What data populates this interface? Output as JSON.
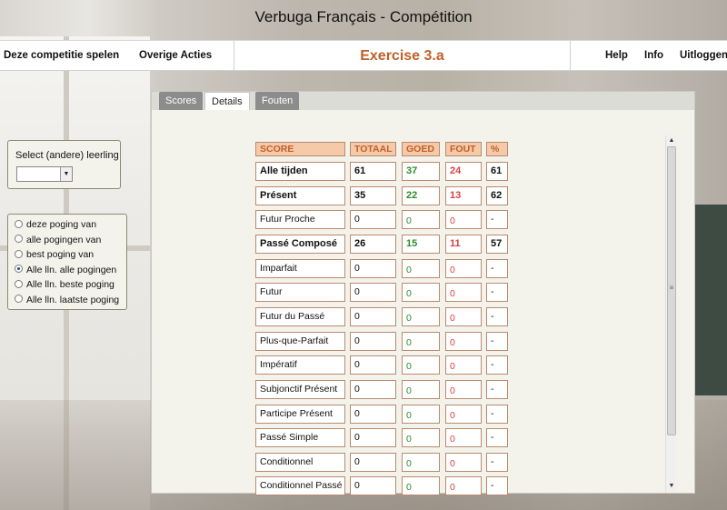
{
  "app": {
    "title": "Verbuga Français - Compétition"
  },
  "menu": {
    "left": [
      "Deze competitie spelen",
      "Overige Acties"
    ],
    "center": "Exercise 3.a",
    "right": [
      "Help",
      "Info",
      "Uitloggen"
    ]
  },
  "tabs": [
    {
      "label": "Scores",
      "active": false
    },
    {
      "label": "Details",
      "active": true
    },
    {
      "label": "Fouten",
      "active": false
    }
  ],
  "table": {
    "headers": [
      "SCORE",
      "TOTAAL",
      "GOED",
      "FOUT",
      "%"
    ],
    "rows": [
      {
        "name": "Alle tijden",
        "totaal": "61",
        "goed": "37",
        "fout": "24",
        "pct": "61",
        "bold": true
      },
      {
        "name": "Présent",
        "totaal": "35",
        "goed": "22",
        "fout": "13",
        "pct": "62",
        "bold": true
      },
      {
        "name": "Futur Proche",
        "totaal": "0",
        "goed": "0",
        "fout": "0",
        "pct": "-",
        "bold": false
      },
      {
        "name": "Passé Composé",
        "totaal": "26",
        "goed": "15",
        "fout": "11",
        "pct": "57",
        "bold": true
      },
      {
        "name": "Imparfait",
        "totaal": "0",
        "goed": "0",
        "fout": "0",
        "pct": "-",
        "bold": false
      },
      {
        "name": "Futur",
        "totaal": "0",
        "goed": "0",
        "fout": "0",
        "pct": "-",
        "bold": false
      },
      {
        "name": "Futur du Passé",
        "totaal": "0",
        "goed": "0",
        "fout": "0",
        "pct": "-",
        "bold": false
      },
      {
        "name": "Plus-que-Parfait",
        "totaal": "0",
        "goed": "0",
        "fout": "0",
        "pct": "-",
        "bold": false
      },
      {
        "name": "Impératif",
        "totaal": "0",
        "goed": "0",
        "fout": "0",
        "pct": "-",
        "bold": false
      },
      {
        "name": "Subjonctif Présent",
        "totaal": "0",
        "goed": "0",
        "fout": "0",
        "pct": "-",
        "bold": false
      },
      {
        "name": "Participe Présent",
        "totaal": "0",
        "goed": "0",
        "fout": "0",
        "pct": "-",
        "bold": false
      },
      {
        "name": "Passé Simple",
        "totaal": "0",
        "goed": "0",
        "fout": "0",
        "pct": "-",
        "bold": false
      },
      {
        "name": "Conditionnel",
        "totaal": "0",
        "goed": "0",
        "fout": "0",
        "pct": "-",
        "bold": false
      },
      {
        "name": "Conditionnel Passé",
        "totaal": "0",
        "goed": "0",
        "fout": "0",
        "pct": "-",
        "bold": false
      }
    ]
  },
  "student_select": {
    "label": "Select (andere) leerling",
    "value": ""
  },
  "attempt_filter": {
    "options": [
      "deze poging van",
      "alle pogingen van",
      "best poging van",
      "Alle lln. alle pogingen",
      "Alle lln. beste poging",
      "Alle lln. laatste poging"
    ],
    "selected_index": 3
  },
  "icons": {
    "dropdown": "chevron-down-icon",
    "scroll_up": "scroll-up-icon",
    "scroll_down": "scroll-down-icon"
  },
  "colors": {
    "accent": "#c0602a",
    "header_bg": "#f6c9a8",
    "good": "#2c8b2c",
    "bad": "#d84040"
  }
}
